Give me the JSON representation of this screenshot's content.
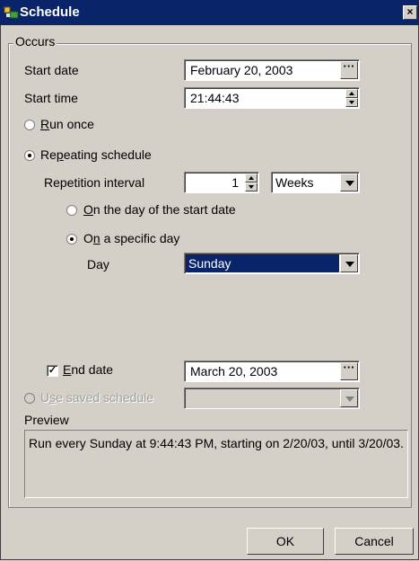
{
  "window": {
    "title": "Schedule",
    "close_glyph": "×"
  },
  "occurs_label": "Occurs",
  "start_date": {
    "label": "Start date",
    "value": "February 20, 2003",
    "picker_glyph": "···"
  },
  "start_time": {
    "label": "Start time",
    "value": "21:44:43"
  },
  "run_once": {
    "label_pre": "",
    "label_u": "R",
    "label_post": "un once",
    "checked": false
  },
  "repeating": {
    "label_pre": "Re",
    "label_u": "p",
    "label_post": "eating schedule",
    "checked": true
  },
  "repetition": {
    "label": "Repetition interval",
    "value": "1",
    "unit": "Weeks"
  },
  "day_option_start": {
    "label_pre": "",
    "label_u": "O",
    "label_post": "n the day of the start date"
  },
  "day_option_specific": {
    "label_pre": "O",
    "label_u": "n",
    "label_post": " a specific day"
  },
  "day": {
    "label": "Day",
    "value": "Sunday"
  },
  "end_date": {
    "label_pre": "",
    "label_u": "E",
    "label_post": "nd date",
    "checked": true,
    "check_glyph": "✓",
    "value": "March 20, 2003",
    "picker_glyph": "···"
  },
  "saved_schedule": {
    "label_pre": "U",
    "label_u": "s",
    "label_post": "e saved schedule",
    "value": ""
  },
  "preview": {
    "label": "Preview",
    "text": "Run every Sunday at 9:44:43 PM, starting on 2/20/03, until 3/20/03."
  },
  "buttons": {
    "ok": "OK",
    "cancel": "Cancel"
  },
  "colors": {
    "title_bar": "#0a246a",
    "face": "#d4d0c8",
    "selection": "#0a246a"
  }
}
